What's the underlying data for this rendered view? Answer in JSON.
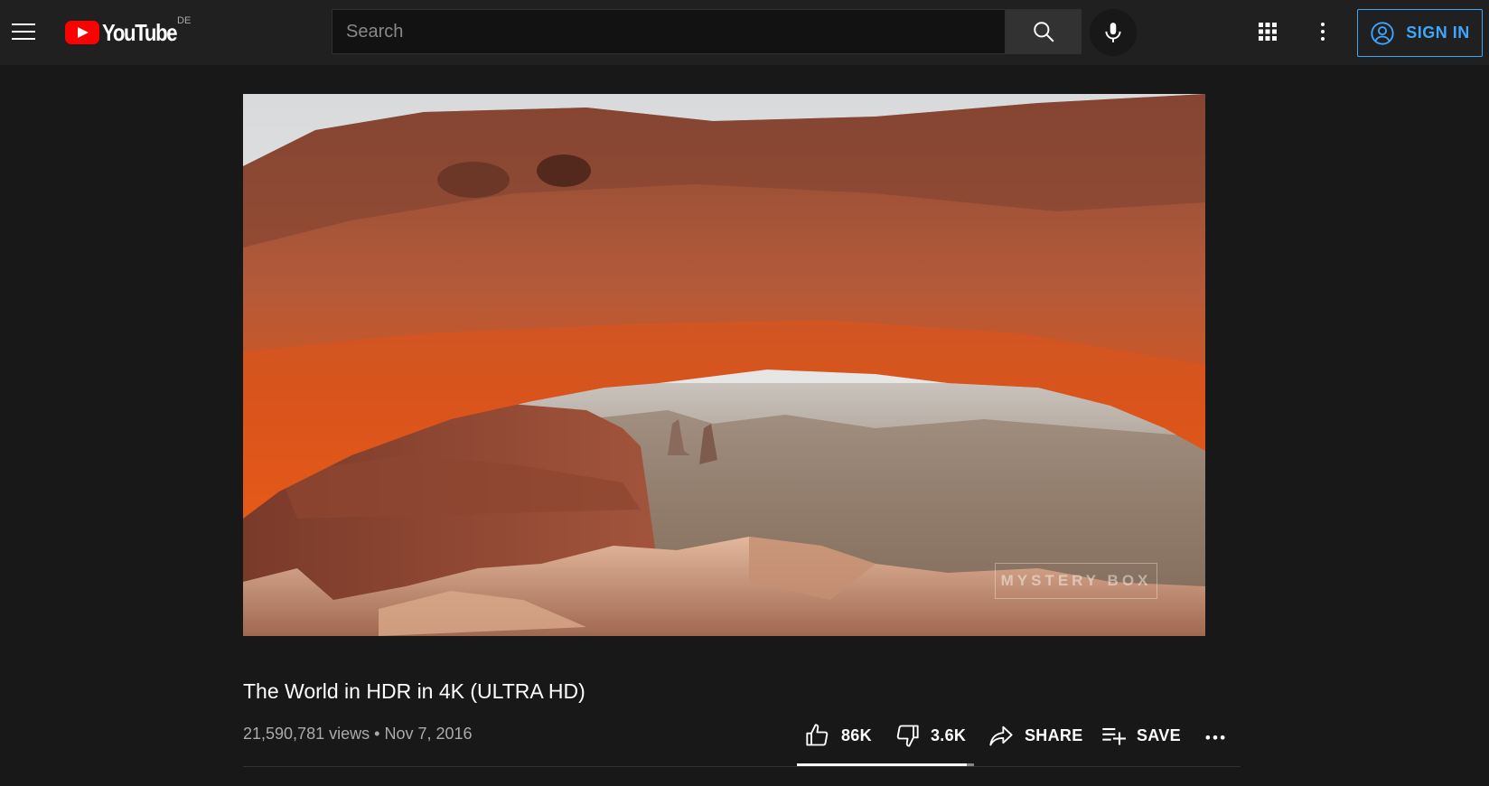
{
  "header": {
    "logo_text": "YouTube",
    "country_code": "DE",
    "search_placeholder": "Search",
    "signin_label": "SIGN IN",
    "accent_color": "#3ea6ff",
    "brand_color": "#ff0000"
  },
  "video": {
    "title": "The World in HDR in 4K (ULTRA HD)",
    "views": "21,590,781 views",
    "separator": "•",
    "date": "Nov 7, 2016",
    "watermark": "MYSTERY BOX"
  },
  "actions": {
    "like_count": "86K",
    "dislike_count": "3.6K",
    "share_label": "SHARE",
    "save_label": "SAVE",
    "like_ratio": 0.9598
  },
  "icons": [
    "menu-icon",
    "youtube-logo-icon",
    "search-icon",
    "mic-icon",
    "apps-grid-icon",
    "more-vert-icon",
    "account-icon",
    "thumb-up-icon",
    "thumb-down-icon",
    "share-icon",
    "playlist-add-icon",
    "more-horiz-icon"
  ]
}
